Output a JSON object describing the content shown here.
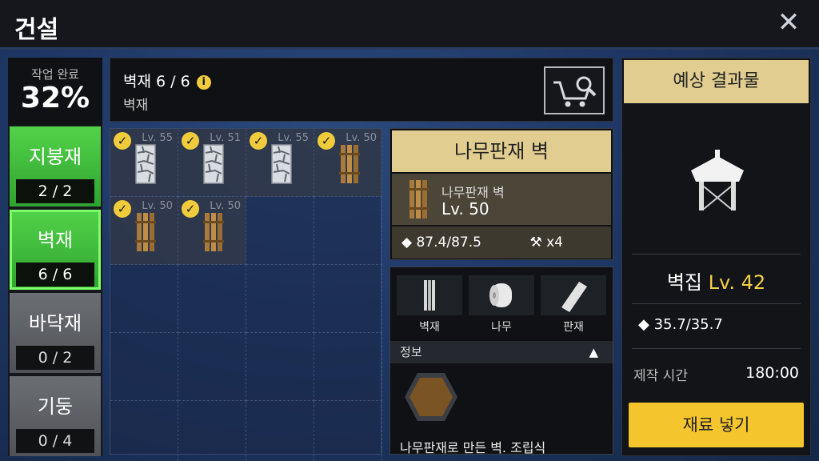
{
  "header": {
    "title": "건설",
    "close_icon": "close-icon"
  },
  "progress": {
    "label": "작업 완료",
    "value": "32%"
  },
  "categories": [
    {
      "name": "지붕재",
      "count": "2 / 2",
      "state": "complete"
    },
    {
      "name": "벽재",
      "count": "6 / 6",
      "state": "selected"
    },
    {
      "name": "바닥재",
      "count": "0 / 2",
      "state": "incomplete"
    },
    {
      "name": "기둥",
      "count": "0 / 4",
      "state": "incomplete"
    }
  ],
  "info": {
    "title": "벽재 6 / 6",
    "subtitle": "벽재",
    "info_icon": "i"
  },
  "grid": {
    "items": [
      {
        "level": "Lv. 55",
        "type": "stone"
      },
      {
        "level": "Lv. 51",
        "type": "stone"
      },
      {
        "level": "Lv. 55",
        "type": "stone"
      },
      {
        "level": "Lv. 50",
        "type": "wood"
      },
      {
        "level": "Lv. 50",
        "type": "wood"
      },
      {
        "level": "Lv. 50",
        "type": "wood"
      }
    ]
  },
  "detail": {
    "name": "나무판재 벽",
    "item_name": "나무판재 벽",
    "item_level": "Lv. 50",
    "weight": "87.4/87.5",
    "hammer_count": "x4"
  },
  "materials": [
    {
      "label": "벽재"
    },
    {
      "label": "나무"
    },
    {
      "label": "판재"
    }
  ],
  "info_section": {
    "label": "정보",
    "arrow": "▲"
  },
  "description": "나무판재로 만든 벽. 조립식",
  "result": {
    "header": "예상 결과물",
    "name": "벽집",
    "level": "Lv. 42",
    "weight": "35.7/35.7",
    "time_label": "제작 시간",
    "time_value": "180:00",
    "button": "재료 넣기"
  }
}
